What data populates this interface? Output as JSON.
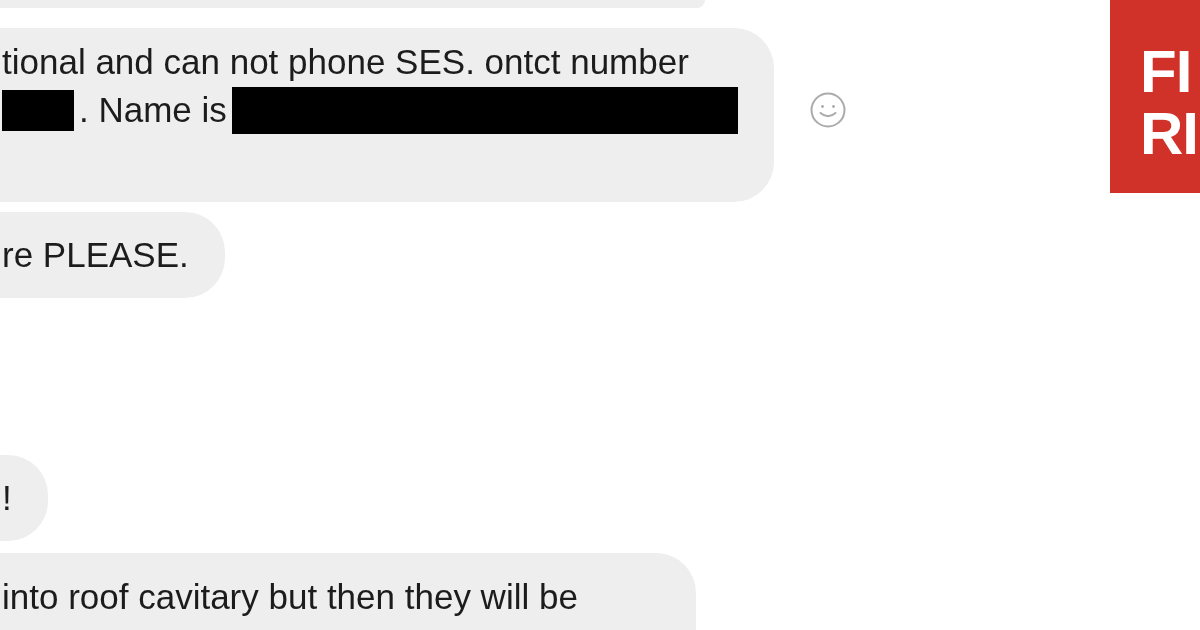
{
  "conversation": {
    "groups": [
      {
        "messages": [
          {
            "kind": "hidden",
            "hovered": false
          },
          {
            "kind": "text",
            "hovered": true,
            "lines": [
              [
                {
                  "kind": "text",
                  "text": "tional and can not phone SES. ontct number"
                }
              ],
              [
                {
                  "kind": "redacted"
                },
                {
                  "kind": "text",
                  "text": ". Name is"
                },
                {
                  "kind": "redacted"
                }
              ]
            ]
          },
          {
            "kind": "text",
            "hovered": false,
            "lines": [
              [
                {
                  "kind": "text",
                  "text": "re PLEASE."
                }
              ]
            ]
          }
        ]
      },
      {
        "messages": [
          {
            "kind": "text",
            "hovered": false,
            "lines": [
              [
                {
                  "kind": "text",
                  "text": "!"
                }
              ]
            ]
          },
          {
            "kind": "text",
            "hovered": false,
            "lines": [
              [
                {
                  "kind": "text",
                  "text": "into roof cavitary but then they will be"
                }
              ]
            ]
          }
        ]
      }
    ]
  },
  "profile": {
    "logo_lines": [
      "FI",
      "RI"
    ]
  }
}
